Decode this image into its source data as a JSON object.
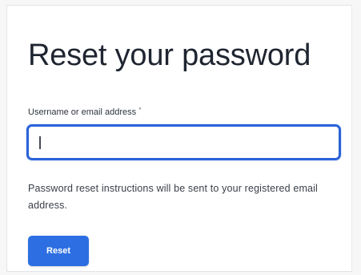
{
  "form": {
    "title": "Reset your password",
    "field_label": "Username or email address",
    "required_mark": "*",
    "input_value": "",
    "help_text": "Password reset instructions will be sent to your registered email address.",
    "submit_label": "Reset"
  },
  "colors": {
    "accent": "#2d6fe3",
    "focus_border": "#2b63d8",
    "title_text": "#1f2530",
    "body_text": "#3a4049"
  }
}
